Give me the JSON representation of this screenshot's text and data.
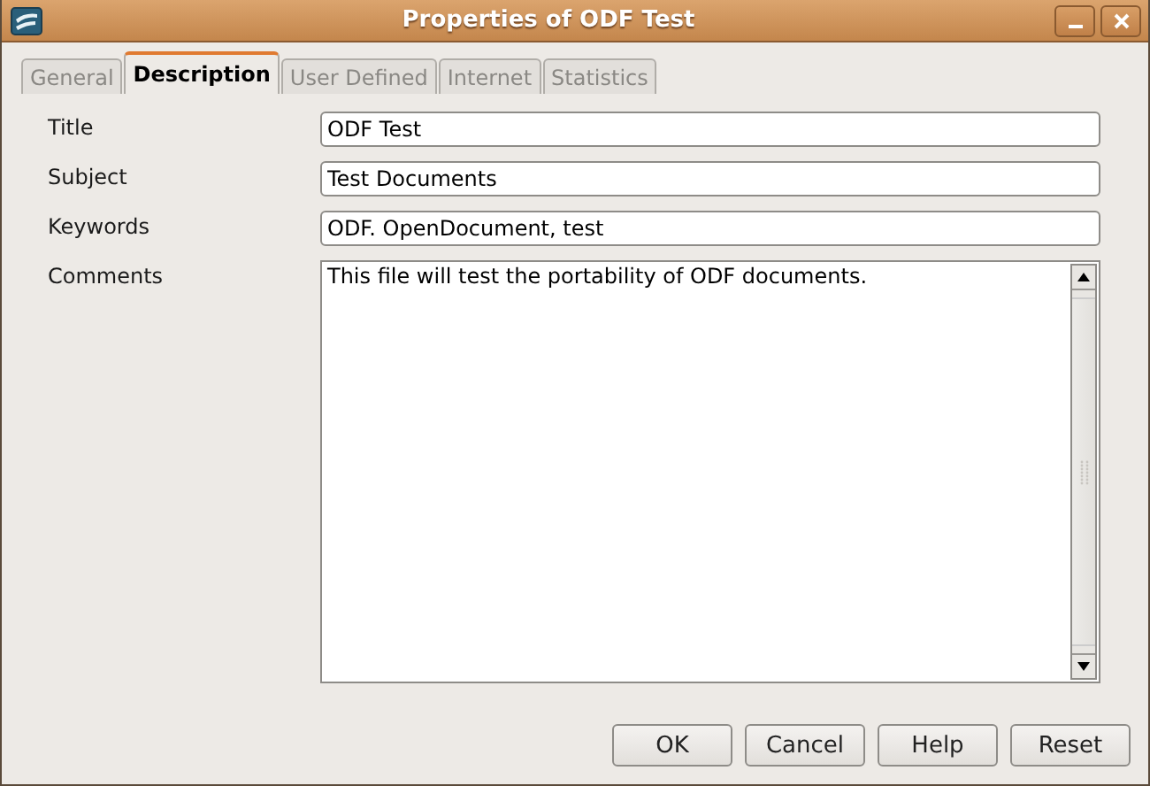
{
  "window": {
    "title": "Properties of ODF Test"
  },
  "tabs": [
    {
      "label": "General",
      "selected": false
    },
    {
      "label": "Description",
      "selected": true
    },
    {
      "label": "User Defined",
      "selected": false
    },
    {
      "label": "Internet",
      "selected": false
    },
    {
      "label": "Statistics",
      "selected": false
    }
  ],
  "fields": [
    {
      "label": "Title",
      "value": "ODF Test"
    },
    {
      "label": "Subject",
      "value": "Test Documents"
    },
    {
      "label": "Keywords",
      "value": "ODF. OpenDocument, test"
    }
  ],
  "comments": {
    "label": "Comments",
    "value": "This file will test the portability of ODF documents."
  },
  "buttons": [
    "OK",
    "Cancel",
    "Help",
    "Reset"
  ]
}
